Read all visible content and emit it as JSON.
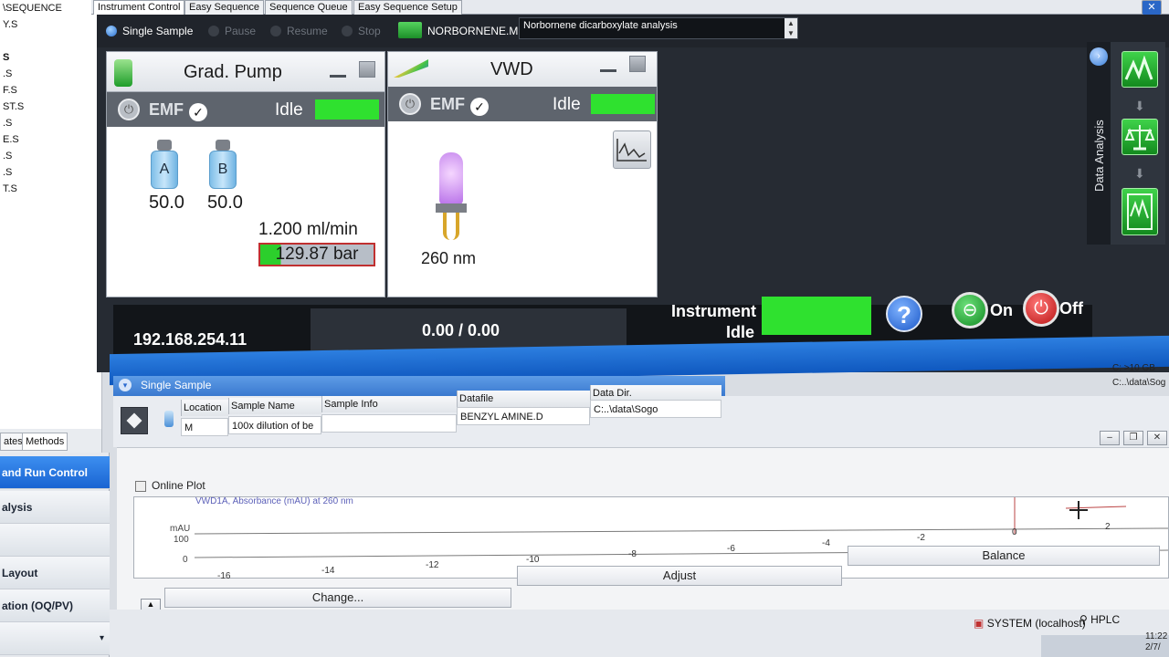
{
  "left_panel": {
    "tree_items": [
      "\\SEQUENCE",
      "Y.S",
      "",
      "S",
      ".S",
      "F.S",
      "ST.S",
      ".S",
      "E.S",
      ".S",
      ".S",
      "T.S"
    ],
    "tabs": [
      "ates",
      "Methods"
    ],
    "nav": [
      "and Run Control",
      "alysis",
      "",
      "Layout",
      "ation (OQ/PV)",
      ""
    ]
  },
  "top_tabs": [
    "Instrument Control",
    "Easy Sequence",
    "Sequence Queue",
    "Easy Sequence Setup"
  ],
  "toolbar": {
    "single_sample": "Single Sample",
    "pause": "Pause",
    "resume": "Resume",
    "stop": "Stop",
    "method_name": "NORBORNENE.M",
    "method_desc": "Norbornene dicarboxylate analysis"
  },
  "pump": {
    "title": "Grad. Pump",
    "emf": "EMF",
    "status": "Idle",
    "bottle_a": "A",
    "bottle_b": "B",
    "value_a": "50.0",
    "value_b": "50.0",
    "flow": "1.200 ml/min",
    "pressure": "129.87 bar"
  },
  "vwd": {
    "title": "VWD",
    "emf": "EMF",
    "status": "Idle",
    "wavelength": "260 nm"
  },
  "status_strip": {
    "ip": "192.168.254.11",
    "progress": "0.00 / 0.00",
    "instrument_label_1": "Instrument",
    "instrument_label_2": "Idle",
    "help": "?",
    "on": "On",
    "off": "Off"
  },
  "data_analysis": {
    "label": "Data Analysis"
  },
  "single_sample": {
    "header": "Single Sample",
    "columns": [
      "Location",
      "Sample Name",
      "Sample Info",
      "Datafile",
      "Data Dir."
    ],
    "row": [
      "M",
      "100x dilution of be",
      "",
      "BENZYL AMINE.D",
      "C:..\\data\\Sogo"
    ]
  },
  "disk": {
    "line1": "C: >10 GB",
    "line2": "C:..\\data\\Sog"
  },
  "online_plot": {
    "title": "Online Plot",
    "signal": "VWD1A, Absorbance (mAU) at 260 nm",
    "y_unit": "mAU",
    "y_ticks": [
      "100",
      "0"
    ],
    "x_ticks": [
      "-16",
      "-14",
      "-12",
      "-10",
      "-8",
      "-6",
      "-4",
      "-2",
      "0",
      "2"
    ],
    "buttons": {
      "change": "Change...",
      "adjust": "Adjust",
      "balance": "Balance"
    }
  },
  "status_bar": {
    "system": "SYSTEM (localhost)",
    "hplc": "HPLC",
    "time": "11:22",
    "date": "2/7/"
  },
  "colors": {
    "idle_green": "#2fe12f",
    "tab_blue": "#1a64d2",
    "panel_dark": "#262b33"
  }
}
